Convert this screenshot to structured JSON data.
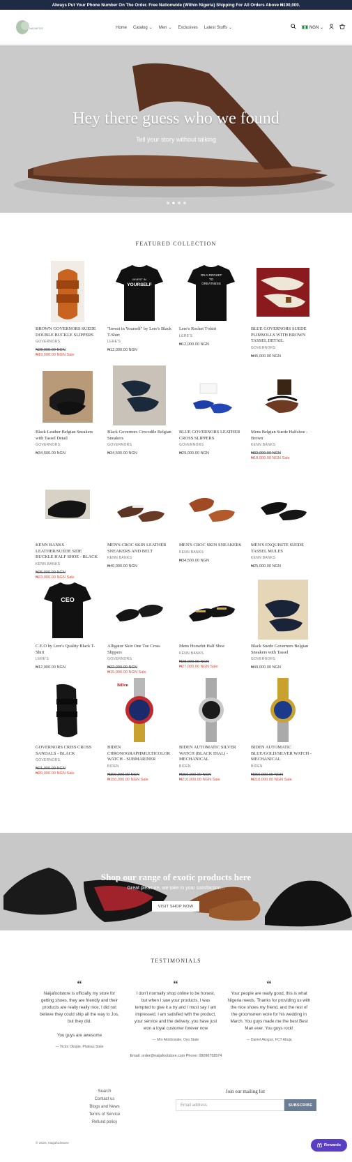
{
  "announcement": "Always Put Your Phone Number On The Order. Free Nationwide (Within Nigeria) Shipping For All Orders Above ₦100,000.",
  "header": {
    "logo_alt": "NAIJAFOOTSTORE",
    "nav": [
      {
        "label": "Home",
        "dropdown": false
      },
      {
        "label": "Catalog",
        "dropdown": true
      },
      {
        "label": "Men",
        "dropdown": true
      },
      {
        "label": "Exclusives",
        "dropdown": false
      },
      {
        "label": "Latest Stuffs",
        "dropdown": true
      }
    ],
    "currency": "NGN",
    "icons": [
      "search-icon",
      "flag-icon",
      "account-icon",
      "cart-icon"
    ]
  },
  "hero": {
    "title": "Hey there guess who we found",
    "subtitle": "Tell your story without talking",
    "slides": 4,
    "active_slide": 2
  },
  "featured": {
    "title": "FEATURED COLLECTION",
    "products": [
      {
        "name": "BROWN GOVERNORS SUEDE DOUBLE BUCKLE SLIPPERS",
        "vendor": "GOVERNORS",
        "old_price": "₦28,000.00 NGN",
        "price": "₦19,500.00 NGN Sale",
        "image": "brown-slipper"
      },
      {
        "name": "\"Invest in Yourself\" by Lere's Black T-Shirt",
        "vendor": "LERE'S",
        "price": "₦12,000.00 NGN",
        "image": "tshirt-invest"
      },
      {
        "name": "Lere's Rocket T-shirt",
        "vendor": "LERE'S",
        "price": "₦12,000.00 NGN",
        "image": "tshirt-rocket"
      },
      {
        "name": "BLUE GOVERNORS SUEDE PLIMSOLLS WITH BROWN TASSEL DETAIL",
        "vendor": "GOVERNORS",
        "price": "₦45,000.00 NGN",
        "image": "blue-plimsolls"
      },
      {
        "name": "Black Leather Belgian Sneakers with Tassel Detail",
        "vendor": "GOVERNORS",
        "price": "₦34,500.00 NGN",
        "image": "black-loafer"
      },
      {
        "name": "Black Governors Crocodile Belgian Sneakers",
        "vendor": "GOVERNORS",
        "price": "₦34,500.00 NGN",
        "image": "croc-loafer"
      },
      {
        "name": "BLUE GOVERNORS LEATHER CROSS SLIPPERS",
        "vendor": "GOVERNORS",
        "price": "₦29,000.00 NGN",
        "image": "blue-slippers"
      },
      {
        "name": "Mens Belgian Suede Halfshoe - Brown",
        "vendor": "KENN BANKS",
        "old_price": "₦32,000.00 NGN",
        "price": "₦18,000.00 NGN Sale",
        "image": "brown-halfshoe"
      },
      {
        "name": "KENN BANKS LEATHER/SUEDE SIDE BUCKLE HALF SHOE - BLACK",
        "vendor": "KENN BANKS",
        "old_price": "₦25,000.00 NGN",
        "price": "₦23,000.00 NGN Sale",
        "image": "black-halfshoe"
      },
      {
        "name": "MEN'S CROC SKIN LEATHER SNEAKERS AND BELT",
        "vendor": "KENN BANKS",
        "price": "₦40,000.00 NGN",
        "image": "croc-sneakers"
      },
      {
        "name": "MEN'S CROC SKIN SNEAKERS",
        "vendor": "KENN BANKS",
        "price": "₦34,500.00 NGN",
        "image": "croc-brown"
      },
      {
        "name": "MEN'S EXQUISITE SUEDE TASSEL MULES",
        "vendor": "KENN BANKS",
        "price": "₦25,000.00 NGN",
        "image": "suede-mules"
      },
      {
        "name": "C.E.O by Lere's Quality Black T-Shirt",
        "vendor": "LERE'S",
        "price": "₦12,000.00 NGN",
        "image": "tshirt-ceo"
      },
      {
        "name": "Alligator Skin One Toe Cross Slippers",
        "vendor": "GOVERNORS",
        "old_price": "₦22,000.00 NGN",
        "price": "₦15,000.00 NGN Sale",
        "image": "alligator-slipper"
      },
      {
        "name": "Mens Horsebit Half Shoe",
        "vendor": "KENN BANKS",
        "old_price": "₦28,000.00 NGN",
        "price": "₦27,000.00 NGN Sale",
        "image": "horsebit"
      },
      {
        "name": "Black Suede Governors Belgian Sneakers with Tassel",
        "vendor": "GOVERNORS",
        "price": "₦49,000.00 NGN",
        "image": "suede-belgian"
      },
      {
        "name": "GOVERNORS CRISS CROSS SANDALS - BLACK",
        "vendor": "GOVERNORS",
        "old_price": "₦21,000.00 NGN",
        "price": "₦20,000.00 NGN Sale",
        "image": "criss-cross"
      },
      {
        "name": "BIDEN CHRONOGRAPHMULTICOLOR WATCH - SUBMARINER",
        "vendor": "BIDEN",
        "old_price": "₦399,990.00 NGN",
        "price": "₦150,000.00 NGN Sale",
        "image": "watch-sub"
      },
      {
        "name": "BIDEN AUTOMATIC SILVER WATCH (BLACK DIAL) - MECHANICAL",
        "vendor": "BIDEN",
        "old_price": "₦350,000.00 NGN",
        "price": "₦210,000.00 NGN Sale",
        "image": "watch-silver"
      },
      {
        "name": "BIDEN AUTOMATIC BLUE/GOLD/SILVER WATCH - MECHANICAL",
        "vendor": "BIDEN",
        "old_price": "₦350,000.00 NGN",
        "price": "₦210,000.00 NGN Sale",
        "image": "watch-blue"
      }
    ]
  },
  "banner": {
    "title": "Shop our range of exotic products here",
    "subtitle": "Great pleasure, we take in your satisfaction...",
    "button": "VISIT SHOP NOW"
  },
  "testimonials": {
    "title": "TESTIMONIALS",
    "items": [
      {
        "text": "Naijafootstore is officially my store for getting shoes, they are friendly and their products are really really nice, I did not believe they could ship all the way to Jos, but they did.\n\nYou guys are awesome",
        "author": "— Victor Okopie, Plateau State"
      },
      {
        "text": "I don't normally shop online to be honest, but when I saw your products, I was tempted to give it a try and I must say I am impressed. I am satisfied with the product, your service and the delivery, you have just won a loyal customer forever now",
        "author": "— Mrs Akinbowale, Oyo State"
      },
      {
        "text": "Your people are really good, this is what Nigeria needs. Thanks for providing us with the nice shoes my friend, and the rest of the groomsmen wore for his wedding in March. You guys made me the best Best Man ever. You guys rock!",
        "author": "— Daniel Akogun, FCT Abuja"
      }
    ],
    "contact": "Email: order@naijafootstore.com Phone: 08096758574"
  },
  "footer": {
    "links": [
      "Search",
      "Contact us",
      "Blogs and News",
      "Terms of Service",
      "Refund policy"
    ],
    "mailing_title": "Join our mailing list",
    "email_placeholder": "Email address",
    "subscribe_label": "SUBSCRIBE",
    "copyright": "© 2020, Naijafootstore",
    "rewards_label": "Rewards"
  },
  "colors": {
    "announcement_bg": "#1f2a44",
    "sale": "#e14c3d",
    "subscribe_bg": "#6a7d92",
    "rewards_bg": "#5a3fc4"
  }
}
